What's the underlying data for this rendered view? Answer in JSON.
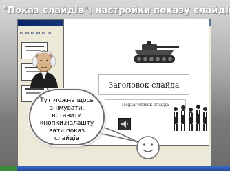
{
  "header": {
    "title": "\"Показ слайдів\": настройки показу слайдів"
  },
  "slide": {
    "title": "Заголовок слайда",
    "subtitle": "Подзаголовок слайда"
  },
  "callout": {
    "lines": [
      "Тут можна щось",
      "анімувати,",
      "вставити",
      "кнопки,налашту",
      "вати показ",
      "слайдів"
    ]
  },
  "icons": {
    "portrait": "portrait-icon",
    "tank": "tank-icon",
    "people": "people-icon",
    "sound": "sound-icon",
    "smiley": "smiley-icon"
  }
}
